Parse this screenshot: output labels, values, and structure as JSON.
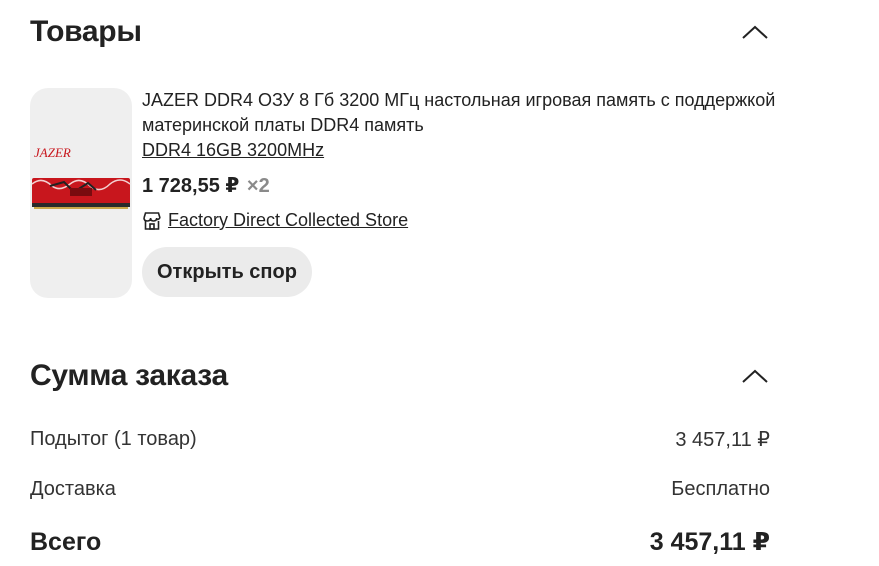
{
  "goods": {
    "title": "Товары",
    "collapse_icon": "chevron-up-icon",
    "product": {
      "brand_logo": "JAZER",
      "title": "JAZER DDR4 ОЗУ 8 Гб 3200 МГц настольная игровая память с поддержкой материнской платы DDR4 память",
      "variant": "DDR4 16GB 3200MHz",
      "price": "1 728,55 ₽",
      "quantity": "×2",
      "store_icon": "store-icon",
      "store_name": "Factory Direct Collected Store",
      "dispute_button": "Открыть спор"
    }
  },
  "summary": {
    "title": "Сумма заказа",
    "collapse_icon": "chevron-up-icon",
    "subtotal_label": "Подытог (1 товар)",
    "subtotal_value": "3 457,11 ₽",
    "delivery_label": "Доставка",
    "delivery_value": "Бесплатно",
    "total_label": "Всего",
    "total_value": "3 457,11 ₽"
  },
  "colors": {
    "text": "#222222",
    "muted": "#8a8a8a",
    "button_bg": "#ebebeb",
    "thumb_bg": "#efefef",
    "ram_red": "#c8161d"
  }
}
